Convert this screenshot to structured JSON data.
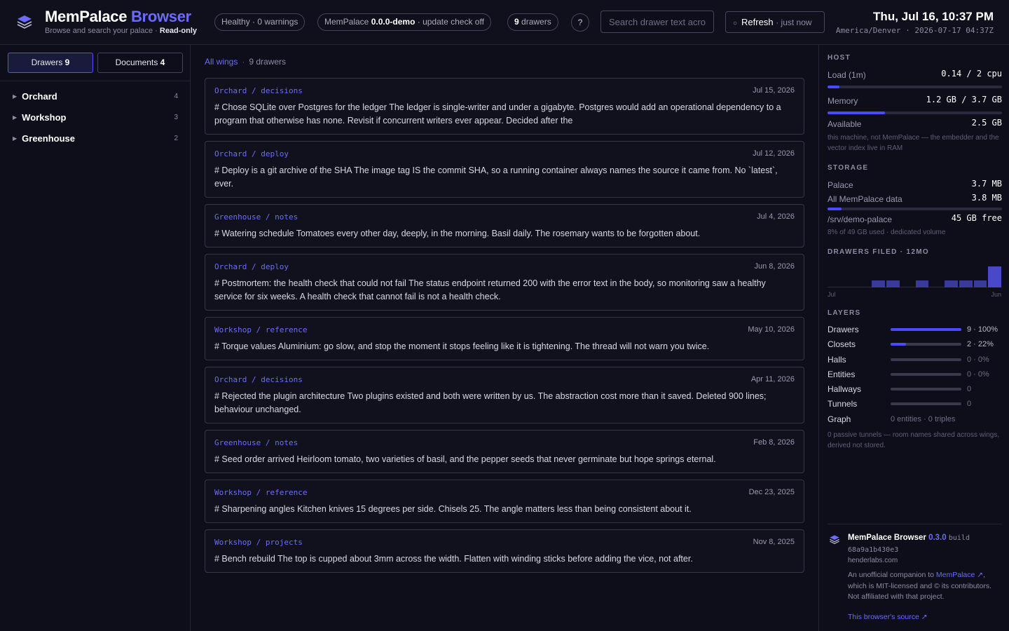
{
  "header": {
    "brand_main": "MemPalace",
    "brand_accent": "Browser",
    "subtitle": "Browse and search your palace ·",
    "mode": "Read-only",
    "health": "Healthy · 0 warnings",
    "version_prefix": "MemPalace",
    "version": "0.0.0-demo",
    "version_suffix": "· update check off",
    "drawer_count": "9",
    "drawer_word": "drawers",
    "help": "?",
    "search_placeholder": "Search drawer text across all wings",
    "refresh_icon": "○",
    "refresh_label": "Refresh",
    "refresh_status": "· just now",
    "clock_time": "Thu, Jul 16, 10:37 PM",
    "clock_zone": "America/Denver · 2026-07-17 04:37Z"
  },
  "sidebar": {
    "tabs": [
      {
        "label": "Drawers",
        "count": "9"
      },
      {
        "label": "Documents",
        "count": "4"
      }
    ],
    "wings": [
      {
        "name": "Orchard",
        "count": "4"
      },
      {
        "name": "Workshop",
        "count": "3"
      },
      {
        "name": "Greenhouse",
        "count": "2"
      }
    ],
    "caret_icon": "▶"
  },
  "main": {
    "crumb_link": "All wings",
    "crumb_sep": "·",
    "crumb_count": "9 drawers",
    "cards": [
      {
        "path": "Orchard / decisions",
        "date": "Jul 15, 2026",
        "text": "# Chose SQLite over Postgres for the ledger The ledger is single-writer and under a gigabyte. Postgres would add an operational dependency to a program that otherwise has none. Revisit if concurrent writers ever appear. Decided after the"
      },
      {
        "path": "Orchard / deploy",
        "date": "Jul 12, 2026",
        "text": "# Deploy is a git archive of the SHA The image tag IS the commit SHA, so a running container always names the source it came from. No `latest`, ever."
      },
      {
        "path": "Greenhouse / notes",
        "date": "Jul 4, 2026",
        "text": "# Watering schedule Tomatoes every other day, deeply, in the morning. Basil daily. The rosemary wants to be forgotten about."
      },
      {
        "path": "Orchard / deploy",
        "date": "Jun 8, 2026",
        "text": "# Postmortem: the health check that could not fail The status endpoint returned 200 with the error text in the body, so monitoring saw a healthy service for six weeks. A health check that cannot fail is not a health check."
      },
      {
        "path": "Workshop / reference",
        "date": "May 10, 2026",
        "text": "# Torque values Aluminium: go slow, and stop the moment it stops feeling like it is tightening. The thread will not warn you twice."
      },
      {
        "path": "Orchard / decisions",
        "date": "Apr 11, 2026",
        "text": "# Rejected the plugin architecture Two plugins existed and both were written by us. The abstraction cost more than it saved. Deleted 900 lines; behaviour unchanged."
      },
      {
        "path": "Greenhouse / notes",
        "date": "Feb 8, 2026",
        "text": "# Seed order arrived Heirloom tomato, two varieties of basil, and the pepper seeds that never germinate but hope springs eternal."
      },
      {
        "path": "Workshop / reference",
        "date": "Dec 23, 2025",
        "text": "# Sharpening angles Kitchen knives 15 degrees per side. Chisels 25. The angle matters less than being consistent about it."
      },
      {
        "path": "Workshop / projects",
        "date": "Nov 8, 2025",
        "text": "# Bench rebuild The top is cupped about 3mm across the width. Flatten with winding sticks before adding the vice, not after."
      }
    ]
  },
  "panel": {
    "host_label": "HOST",
    "load_label": "Load (1m)",
    "load_value": "0.14 / 2 cpu",
    "load_fraction": 0.07,
    "memory_label": "Memory",
    "memory_value": "1.2 GB / 3.7 GB",
    "memory_fraction": 0.33,
    "available_label": "Available",
    "available_value": "2.5 GB",
    "host_note": "this machine, not MemPalace — the embedder and the vector index live in RAM",
    "storage_label": "STORAGE",
    "palace_label": "Palace",
    "palace_value": "3.7 MB",
    "alldata_label": "All MemPalace data",
    "alldata_value": "3.8 MB",
    "disk_fraction": 0.08,
    "disk_label": "/srv/demo-palace",
    "disk_value": "45 GB free",
    "disk_note": "8% of 49 GB used · dedicated volume",
    "filed_label": "DRAWERS FILED · 12MO",
    "filed_start": "Jul",
    "filed_end": "Jun",
    "filed_monthly": [
      0,
      0,
      0,
      1,
      1,
      0,
      1,
      0,
      1,
      1,
      1,
      3
    ],
    "layers_label": "LAYERS",
    "layers": [
      {
        "name": "Drawers",
        "value": "9 · 100%",
        "fraction": 1.0
      },
      {
        "name": "Closets",
        "value": "2 · 22%",
        "fraction": 0.22
      },
      {
        "name": "Halls",
        "value": "0 · 0%",
        "fraction": 0
      },
      {
        "name": "Entities",
        "value": "0 · 0%",
        "fraction": 0
      },
      {
        "name": "Hallways",
        "value": "0",
        "fraction": 0
      },
      {
        "name": "Tunnels",
        "value": "0",
        "fraction": 0
      }
    ],
    "graph_label": "Graph",
    "graph_value": "0 entities · 0 triples",
    "layers_note": "0 passive tunnels — room names shared across wings, derived not stored."
  },
  "footer": {
    "name": "MemPalace Browser",
    "version": "0.3.0",
    "build_word": "build",
    "hash": "68a9a1b430e3",
    "host": "henderlabs.com",
    "body_pre": "An unofficial companion to",
    "body_link": "MemPalace ↗",
    "body_post": ", which is MIT-licensed and © its contributors. Not affiliated with that project.",
    "source_link": "This browser's source ↗"
  },
  "colors": {
    "accent": "#6b6bff",
    "bar_fill": "#4a4aff",
    "background": "#0e0e1a"
  }
}
